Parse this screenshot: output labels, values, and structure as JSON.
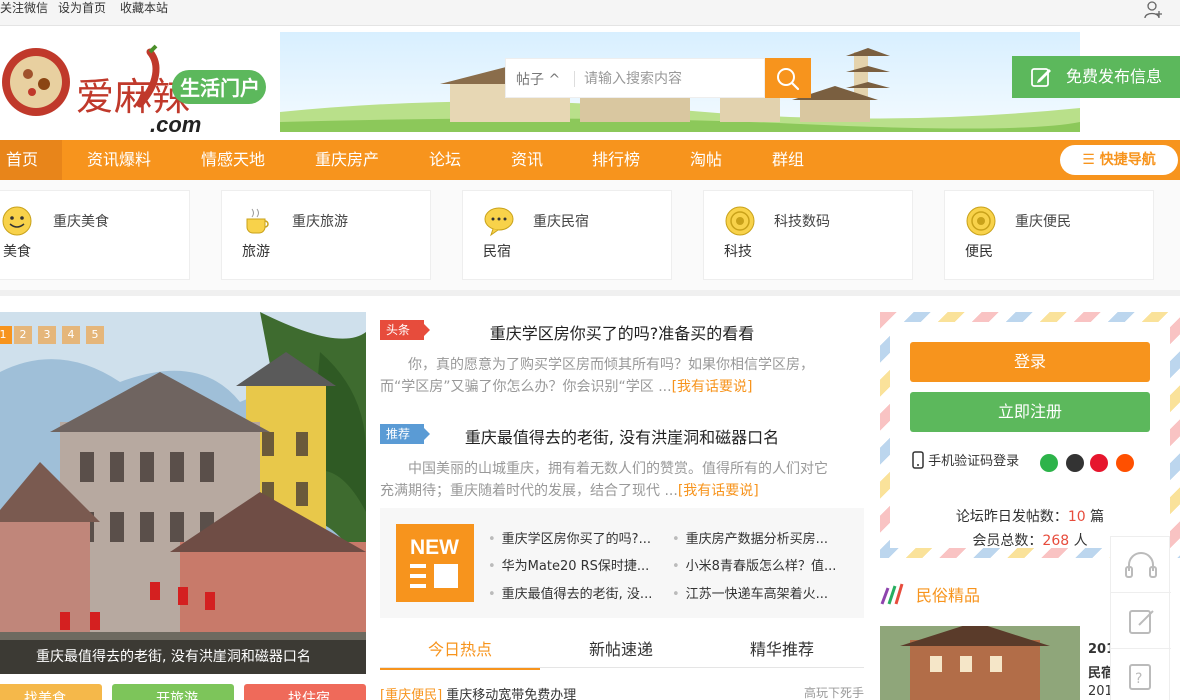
{
  "topbar": {
    "follow_wechat": "关注微信",
    "set_home": "设为首页",
    "bookmark": "收藏本站"
  },
  "logo": {
    "brand": "爱麻辣",
    "domain": ".com",
    "slogan": "生活门户"
  },
  "search": {
    "scope": "帖子 ^",
    "placeholder": "请输入搜索内容"
  },
  "publish": {
    "label": "免费发布信息"
  },
  "nav": {
    "items": [
      "首页",
      "资讯爆料",
      "情感天地",
      "重庆房产",
      "论坛",
      "资讯",
      "排行榜",
      "淘帖",
      "群组"
    ],
    "quick": "☰ 快捷导航"
  },
  "categories": [
    {
      "title": "重庆美食",
      "sub": "美食",
      "icon": "smiley-icon"
    },
    {
      "title": "重庆旅游",
      "sub": "旅游",
      "icon": "coffee-cup-icon"
    },
    {
      "title": "重庆民宿",
      "sub": "民宿",
      "icon": "speech-bubble-icon"
    },
    {
      "title": "科技数码",
      "sub": "科技",
      "icon": "target-icon"
    },
    {
      "title": "重庆便民",
      "sub": "便民",
      "icon": "target-icon"
    }
  ],
  "slider": {
    "pages": [
      "1",
      "2",
      "3",
      "4",
      "5"
    ],
    "active_page": "1",
    "caption": "重庆最值得去的老街, 没有洪崖洞和磁器口名"
  },
  "bottom_buttons": [
    "找美食",
    "开旅游",
    "找住宿"
  ],
  "articles": [
    {
      "tag": "头条",
      "title": "重庆学区房你买了的吗?准备买的看看",
      "excerpt_line1": "你，真的愿意为了购买学区房而倾其所有吗？如果你相信学区房，",
      "excerpt_line2": "而“学区房”又骗了你怎么办？你会识别“学区 ...",
      "more": "[我有话要说]"
    },
    {
      "tag": "推荐",
      "title": "重庆最值得去的老街, 没有洪崖洞和磁器口名",
      "excerpt_line1": "中国美丽的山城重庆，拥有着无数人们的赞赏。值得所有的人们对它",
      "excerpt_line2": "充满期待；重庆随着时代的发展，结合了现代 ...",
      "more": "[我有话要说]"
    }
  ],
  "new_box": {
    "badge": "NEW",
    "links": [
      "重庆学区房你买了的吗?...",
      "重庆房产数据分析买房...",
      "华为Mate20 RS保时捷...",
      "小米8青春版怎么样？值...",
      "重庆最值得去的老街, 没...",
      "江苏一快递车高架着火..."
    ]
  },
  "tabs": {
    "items": [
      "今日热点",
      "新帖速递",
      "精华推荐"
    ],
    "active": 0
  },
  "news": [
    {
      "category": "[重庆便民]",
      "title": "重庆移动宽带免费办理",
      "author": "高玩下死手"
    }
  ],
  "login": {
    "login_label": "登录",
    "register_label": "立即注册",
    "phone_login": "手机验证码登录",
    "stat1_label": "论坛昨日发帖数：",
    "stat1_value": "10",
    "stat1_unit": " 篇",
    "stat2_label": "会员总数：",
    "stat2_value": "268",
    "stat2_unit": " 人"
  },
  "folk": {
    "title": "民俗精品",
    "snippet1": "201",
    "snippet2": "民宿",
    "snippet3": "201"
  },
  "colors": {
    "accent": "#f7941d",
    "green": "#5cb85c",
    "red": "#e74c3c"
  }
}
